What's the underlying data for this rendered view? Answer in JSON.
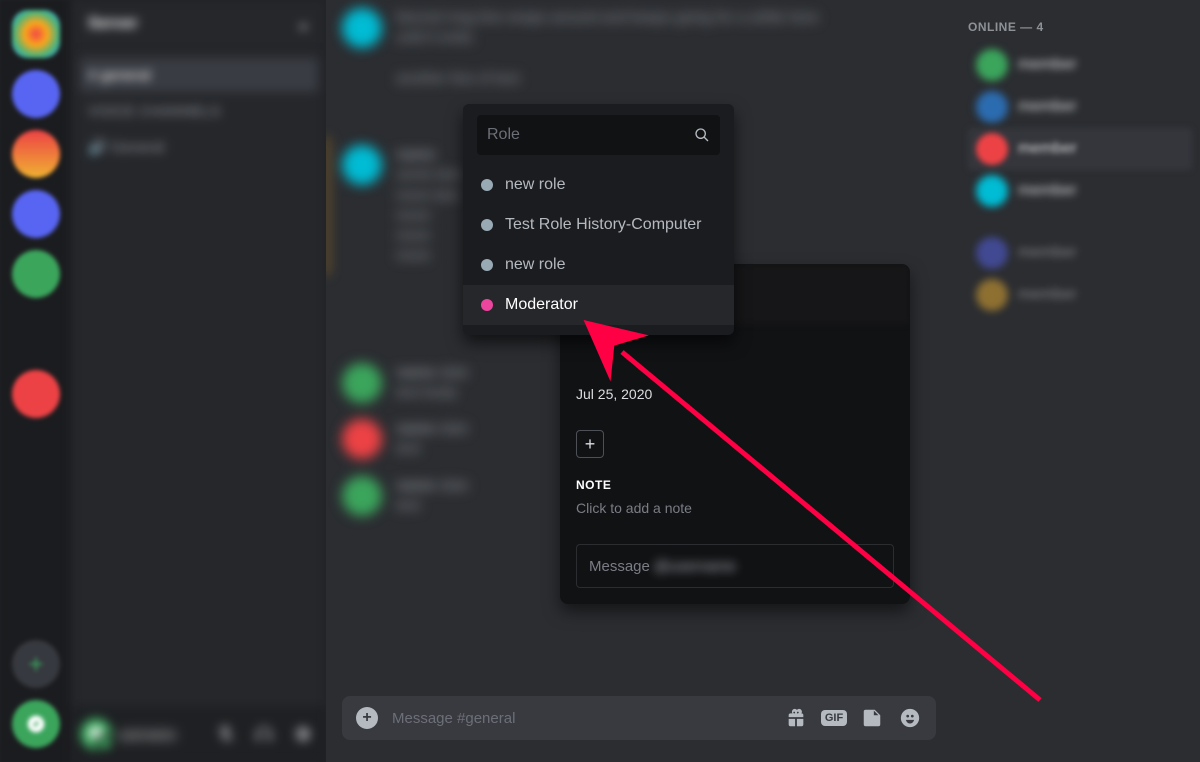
{
  "members_panel": {
    "header": "ONLINE — 4"
  },
  "profile_popover": {
    "member_since": "Jul 25, 2020",
    "note_label": "NOTE",
    "note_placeholder": "Click to add a note",
    "dm_prefix": "Message"
  },
  "role_picker": {
    "search_placeholder": "Role",
    "options": [
      {
        "label": "new role",
        "color": "default"
      },
      {
        "label": "Test Role History-Computer",
        "color": "default"
      },
      {
        "label": "new role",
        "color": "default"
      },
      {
        "label": "Moderator",
        "color": "pink",
        "hover": true
      }
    ]
  },
  "compose": {
    "placeholder": "Message #general",
    "gif_label": "GIF"
  }
}
